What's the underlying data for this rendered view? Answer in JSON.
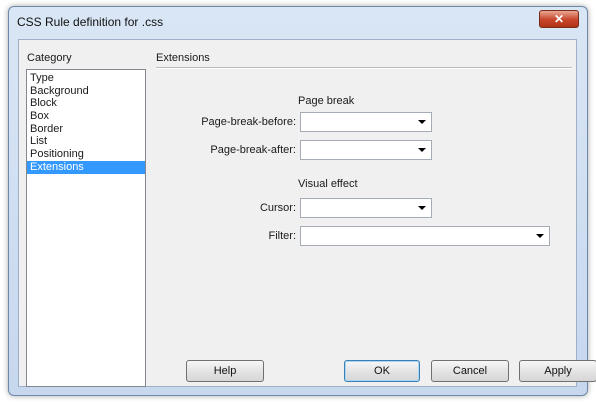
{
  "window": {
    "title": "CSS Rule definition for .css",
    "close_glyph": "✕"
  },
  "category": {
    "label": "Category",
    "items": [
      "Type",
      "Background",
      "Block",
      "Box",
      "Border",
      "List",
      "Positioning",
      "Extensions"
    ],
    "selected": "Extensions"
  },
  "panel": {
    "title": "Extensions",
    "page_break": {
      "heading": "Page break",
      "before_label": "Page-break-before:",
      "before_value": "",
      "after_label": "Page-break-after:",
      "after_value": ""
    },
    "visual_effect": {
      "heading": "Visual effect",
      "cursor_label": "Cursor:",
      "cursor_value": "",
      "filter_label": "Filter:",
      "filter_value": ""
    }
  },
  "buttons": {
    "help": "Help",
    "ok": "OK",
    "cancel": "Cancel",
    "apply": "Apply"
  },
  "colors": {
    "selection": "#3399ff",
    "close_button": "#c7452b",
    "frame": "#c6d7ee"
  },
  "icons": {
    "dropdown": "chevron-down-icon",
    "close": "close-icon"
  }
}
